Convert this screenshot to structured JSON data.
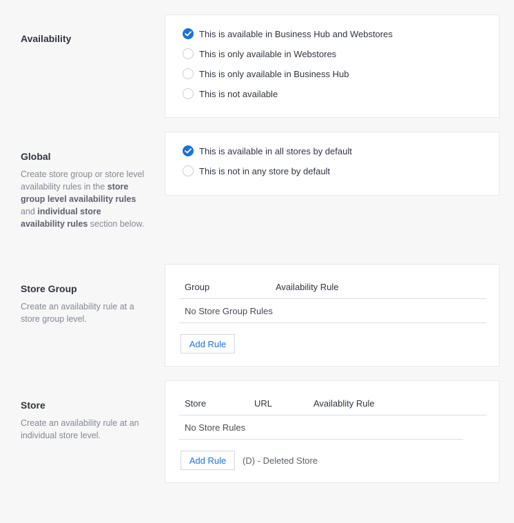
{
  "availability": {
    "title": "Availability",
    "options": [
      {
        "label": "This is available in Business Hub and Webstores",
        "checked": true
      },
      {
        "label": "This is only available in Webstores",
        "checked": false
      },
      {
        "label": "This is only available in Business Hub",
        "checked": false
      },
      {
        "label": "This is not available",
        "checked": false
      }
    ]
  },
  "global": {
    "title": "Global",
    "desc_1": "Create store group or store level availability rules in the",
    "desc_bold_1": "store group level availability rules",
    "desc_2": "and",
    "desc_bold_2": "individual store availability rules",
    "desc_3": "section below.",
    "options": [
      {
        "label": "This is available in all stores by default",
        "checked": true
      },
      {
        "label": "This is not in any store by default",
        "checked": false
      }
    ]
  },
  "store_group": {
    "title": "Store Group",
    "desc": "Create an availability rule at a store group level.",
    "columns": [
      "Group",
      "Availability Rule"
    ],
    "empty_text": "No Store Group Rules",
    "add_button": "Add Rule"
  },
  "store": {
    "title": "Store",
    "desc": "Create an availability rule at an individual store level.",
    "columns": [
      "Store",
      "URL",
      "Availablity Rule"
    ],
    "empty_text": "No Store Rules",
    "add_button": "Add Rule",
    "note": "(D) - Deleted Store"
  },
  "colors": {
    "accent": "#1a73d9",
    "page_bg": "#f7f7f7",
    "card_bg": "#ffffff",
    "text": "#313440",
    "muted": "#858895"
  }
}
